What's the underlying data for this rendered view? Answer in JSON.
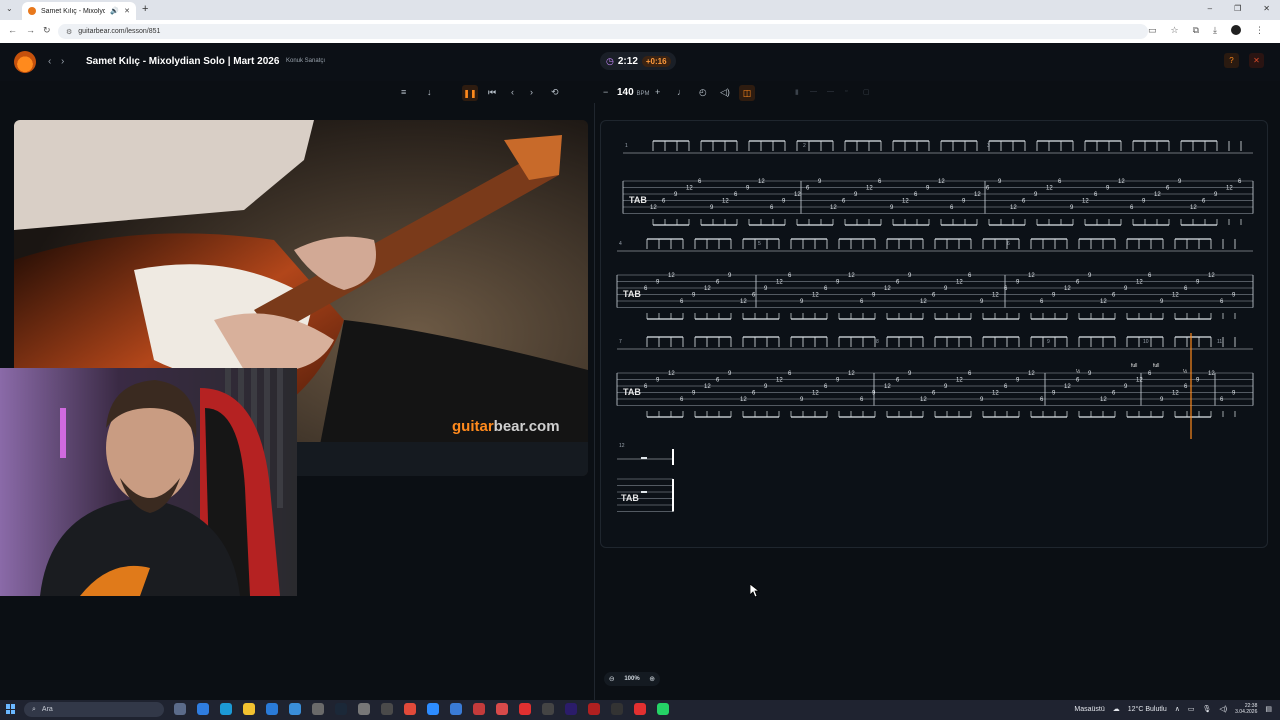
{
  "browser": {
    "tab_title": "Samet Kılıç - Mixolydian So",
    "url": "guitarbear.com/lesson/851",
    "window_controls": [
      "–",
      "❐",
      "✕"
    ]
  },
  "header": {
    "lesson_title": "Samet Kılıç - Mixolydian Solo | Mart 2026",
    "lesson_subtitle": "Konuk Sanatçı",
    "timer_value": "2:12",
    "timer_delta": "+0:16",
    "help_label": "?",
    "close_label": "✕"
  },
  "toolbar": {
    "bpm_value": "140",
    "bpm_unit": "BPM",
    "bpm_minus": "−",
    "bpm_plus": "+"
  },
  "video": {
    "watermark_a": "guitar",
    "watermark_b": "bear.com"
  },
  "tab": {
    "measure_numbers": [
      "1",
      "2",
      "3",
      "4",
      "5",
      "6",
      "7",
      "8",
      "9",
      "10",
      "11",
      "12"
    ],
    "annotations": [
      "full",
      "full",
      "½",
      "½"
    ]
  },
  "zoom": {
    "value": "100%"
  },
  "taskbar": {
    "search_placeholder": "Ara",
    "desktop_label": "Masaüstü",
    "weather": "12°C  Bulutlu",
    "time": "22:38",
    "date": "3.04.2026"
  },
  "colors": {
    "accent": "#ff8a1d",
    "background": "#0b0f14",
    "panel": "#0c1117"
  }
}
